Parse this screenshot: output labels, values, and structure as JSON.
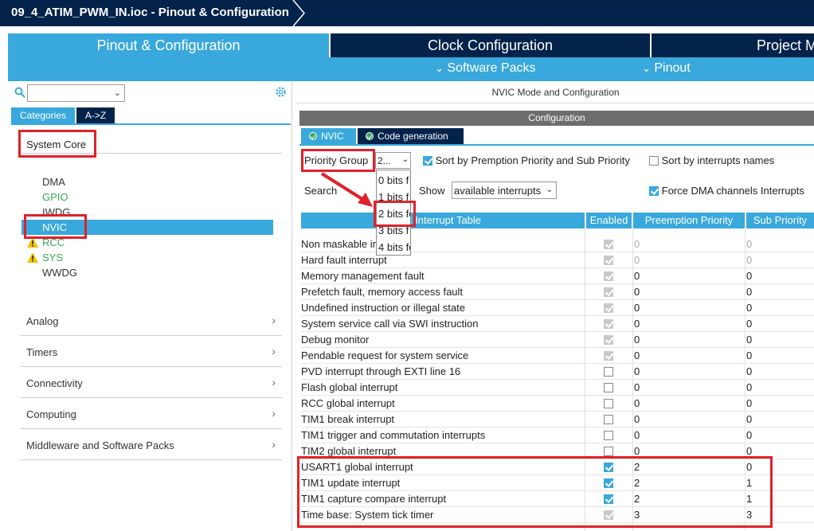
{
  "window": {
    "title": "09_4_ATIM_PWM_IN.ioc - Pinout & Configuration"
  },
  "tabs": {
    "pinout": "Pinout & Configuration",
    "clock": "Clock Configuration",
    "project": "Project M"
  },
  "subbar": {
    "software_packs": "Software Packs",
    "pinout": "Pinout"
  },
  "left": {
    "tab_categories": "Categories",
    "tab_az": "A->Z",
    "system_core": "System Core",
    "items": [
      {
        "label": "DMA",
        "color": "default",
        "warn": false
      },
      {
        "label": "GPIO",
        "color": "green",
        "warn": false
      },
      {
        "label": "IWDG",
        "color": "default",
        "warn": false
      },
      {
        "label": "NVIC",
        "color": "selected",
        "warn": false
      },
      {
        "label": "RCC",
        "color": "green",
        "warn": true
      },
      {
        "label": "SYS",
        "color": "green",
        "warn": true
      },
      {
        "label": "WWDG",
        "color": "default",
        "warn": false
      }
    ],
    "sections": [
      "Analog",
      "Timers",
      "Connectivity",
      "Computing",
      "Middleware and Software Packs"
    ]
  },
  "right": {
    "mode_title": "NVIC Mode and Configuration",
    "config_title": "Configuration",
    "tab_nvic": "NVIC",
    "tab_code": "Code generation",
    "priority_group_label": "Priority Group",
    "priority_group_value": "2...",
    "sort_by_priority": "Sort by Premption Priority and Sub Priority",
    "sort_by_names": "Sort by interrupts names",
    "search_label": "Search",
    "show_label": "Show",
    "show_value": "available interrupts",
    "force_dma": "Force DMA channels Interrupts",
    "priority_options": [
      "0 bits f",
      "1 bits f",
      "2 bits fo",
      "3 bits f",
      "4 bits fo"
    ]
  },
  "table": {
    "headers": {
      "name": "C Interrupt Table",
      "enabled": "Enabled",
      "preemption": "Preemption Priority",
      "sub": "Sub Priority"
    },
    "rows": [
      {
        "name": "Non maskable in",
        "enabled": true,
        "locked": true,
        "pre": "0",
        "sub": "0",
        "grey": true
      },
      {
        "name": "Hard fault interrupt",
        "enabled": true,
        "locked": true,
        "pre": "0",
        "sub": "0",
        "grey": true
      },
      {
        "name": "Memory management fault",
        "enabled": true,
        "locked": true,
        "pre": "0",
        "sub": "0",
        "grey": false
      },
      {
        "name": "Prefetch fault, memory access fault",
        "enabled": true,
        "locked": true,
        "pre": "0",
        "sub": "0",
        "grey": false
      },
      {
        "name": "Undefined instruction or illegal state",
        "enabled": true,
        "locked": true,
        "pre": "0",
        "sub": "0",
        "grey": false
      },
      {
        "name": "System service call via SWI instruction",
        "enabled": true,
        "locked": true,
        "pre": "0",
        "sub": "0",
        "grey": false
      },
      {
        "name": "Debug monitor",
        "enabled": true,
        "locked": true,
        "pre": "0",
        "sub": "0",
        "grey": false
      },
      {
        "name": "Pendable request for system service",
        "enabled": true,
        "locked": true,
        "pre": "0",
        "sub": "0",
        "grey": false
      },
      {
        "name": "PVD interrupt through EXTI line 16",
        "enabled": false,
        "locked": false,
        "pre": "0",
        "sub": "0",
        "grey": false
      },
      {
        "name": "Flash global interrupt",
        "enabled": false,
        "locked": false,
        "pre": "0",
        "sub": "0",
        "grey": false
      },
      {
        "name": "RCC global interrupt",
        "enabled": false,
        "locked": false,
        "pre": "0",
        "sub": "0",
        "grey": false
      },
      {
        "name": "TIM1 break interrupt",
        "enabled": false,
        "locked": false,
        "pre": "0",
        "sub": "0",
        "grey": false
      },
      {
        "name": "TIM1 trigger and commutation interrupts",
        "enabled": false,
        "locked": false,
        "pre": "0",
        "sub": "0",
        "grey": false
      },
      {
        "name": "TIM2 global interrupt",
        "enabled": false,
        "locked": false,
        "pre": "0",
        "sub": "0",
        "grey": false
      },
      {
        "name": "USART1 global interrupt",
        "enabled": true,
        "locked": false,
        "pre": "2",
        "sub": "0",
        "grey": false
      },
      {
        "name": "TIM1 update interrupt",
        "enabled": true,
        "locked": false,
        "pre": "2",
        "sub": "1",
        "grey": false
      },
      {
        "name": "TIM1 capture compare interrupt",
        "enabled": true,
        "locked": false,
        "pre": "2",
        "sub": "1",
        "grey": false
      },
      {
        "name": "Time base: System tick timer",
        "enabled": true,
        "locked": true,
        "pre": "3",
        "sub": "3",
        "grey": false
      }
    ]
  },
  "colors": {
    "accent": "#39a8dc",
    "navy": "#03234b",
    "highlight": "#e0212b",
    "green": "#3aa65c"
  }
}
